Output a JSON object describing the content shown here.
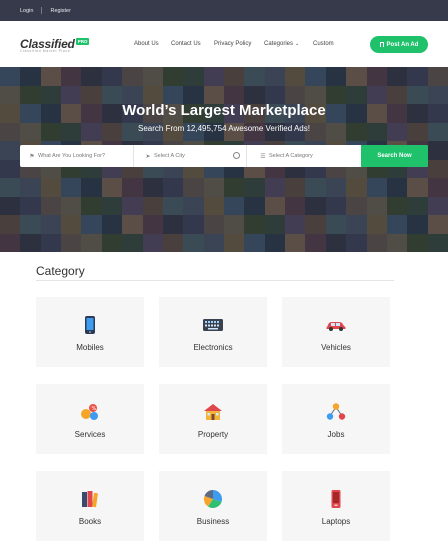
{
  "topbar": {
    "login": "Login",
    "register": "Register"
  },
  "logo": {
    "name": "Classified",
    "badge": "PRO",
    "tagline": "Classified Market Place"
  },
  "nav": {
    "about": "About Us",
    "contact": "Contact Us",
    "privacy": "Privacy Policy",
    "categories": "Categories",
    "custom": "Custom"
  },
  "header": {
    "post_ad": "Post An Ad"
  },
  "hero": {
    "title": "World’s Largest Marketplace",
    "subtitle": "Search From 12,495,754 Awesome Verified Ads!"
  },
  "search": {
    "keyword_placeholder": "What Are You Looking For?",
    "city_placeholder": "Select A City",
    "category_placeholder": "Select A Category",
    "button": "Search Now"
  },
  "category": {
    "title": "Category",
    "items": [
      {
        "label": "Mobiles",
        "icon": "mobile-phone-icon"
      },
      {
        "label": "Electronics",
        "icon": "keyboard-icon"
      },
      {
        "label": "Vehicles",
        "icon": "car-icon"
      },
      {
        "label": "Services",
        "icon": "services-icon"
      },
      {
        "label": "Property",
        "icon": "house-icon"
      },
      {
        "label": "Jobs",
        "icon": "people-network-icon"
      },
      {
        "label": "Books",
        "icon": "books-icon"
      },
      {
        "label": "Business",
        "icon": "pie-chart-icon"
      },
      {
        "label": "Laptops",
        "icon": "laptop-icon"
      }
    ]
  },
  "colors": {
    "accent": "#1fc16b",
    "topbar": "#363a4b"
  }
}
